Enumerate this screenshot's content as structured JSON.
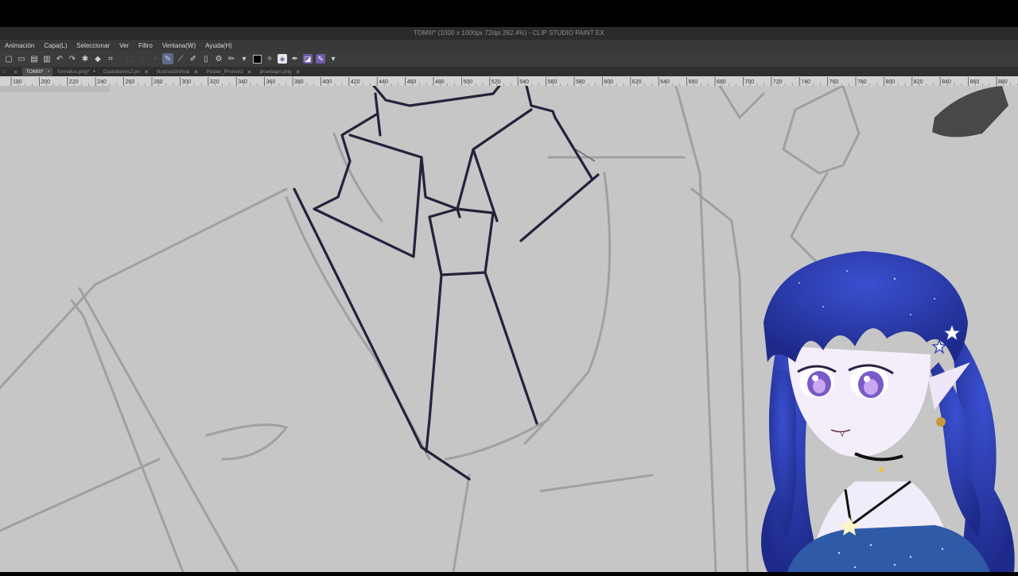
{
  "app": {
    "title": "TOMIII* (1000 x 1000px 72dpi 262.4%)  - CLIP STUDIO PAINT EX"
  },
  "menu": [
    "Animación",
    "Capa(L)",
    "Seleccionar",
    "Ver",
    "Filtro",
    "Ventana(W)",
    "Ayuda(H)"
  ],
  "tabs": [
    {
      "label": "TOMIII*",
      "active": true
    },
    {
      "label": "formalus.png*",
      "active": false
    },
    {
      "label": "Guardianes2.pn",
      "active": false
    },
    {
      "label": "Ilustraciónfinal",
      "active": false
    },
    {
      "label": "Poster_Promoci",
      "active": false
    },
    {
      "label": "pruebapn.png",
      "active": false
    }
  ],
  "ruler": {
    "ticks": [
      "180",
      "200",
      "220",
      "240",
      "260",
      "280",
      "300",
      "320",
      "340",
      "360",
      "380",
      "400",
      "420",
      "440",
      "460",
      "480",
      "500",
      "520",
      "540",
      "560",
      "580",
      "600",
      "620",
      "640",
      "660",
      "680",
      "700",
      "720",
      "740",
      "760",
      "780",
      "800",
      "820",
      "840",
      "860",
      "880"
    ]
  },
  "colors": {
    "canvas_bg": "#c6c6c6",
    "sketch": "#9d9d9d",
    "lineart": "#23233a",
    "avatar_hair": "#2a3aa8"
  },
  "toolbar_icons": [
    "new-file-icon",
    "open-folder-icon",
    "save-icon",
    "print-icon",
    "undo-icon",
    "redo-icon",
    "clear-icon",
    "fill-icon",
    "transform-icon",
    "sep",
    "selection-icon",
    "lasso-icon",
    "pen-icon",
    "pen-active-icon",
    "ruler-icon",
    "edit-icon",
    "sep",
    "pencil-icon",
    "chevron-down-icon",
    "color-swatch",
    "eraser-icon",
    "fill-color-icon",
    "brush-icon",
    "layer-icon",
    "pen-purple-icon",
    "chevron-down-icon"
  ]
}
